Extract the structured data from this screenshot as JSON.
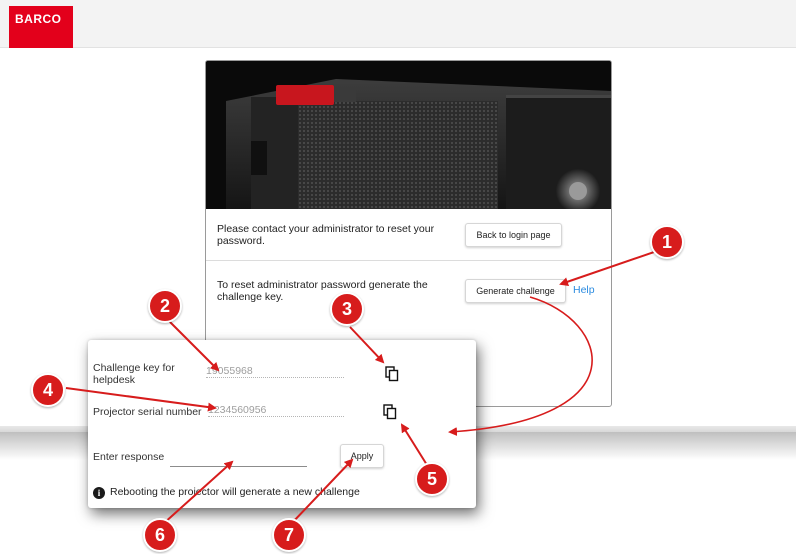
{
  "header": {
    "brand": "BARCO"
  },
  "card": {
    "admin_message": "Please contact your administrator to reset your password.",
    "back_button": "Back to login page",
    "reset_message": "To reset administrator password generate the challenge key.",
    "generate_button": "Generate challenge",
    "help_link": "Help"
  },
  "zoom_panel": {
    "challenge_label": "Challenge key for helpdesk",
    "challenge_value": "19055968",
    "serial_label": "Projector serial number",
    "serial_value": "1234560956",
    "response_label": "Enter response",
    "response_value": "",
    "apply_button": "Apply",
    "notice": "Rebooting the projector will generate a new challenge"
  },
  "callouts": [
    "1",
    "2",
    "3",
    "4",
    "5",
    "6",
    "7"
  ],
  "icons": {
    "copy": "copy-icon",
    "info": "info-icon"
  },
  "colors": {
    "brand": "#e3001b",
    "callout": "#d71c1c",
    "link": "#2b8be0"
  }
}
